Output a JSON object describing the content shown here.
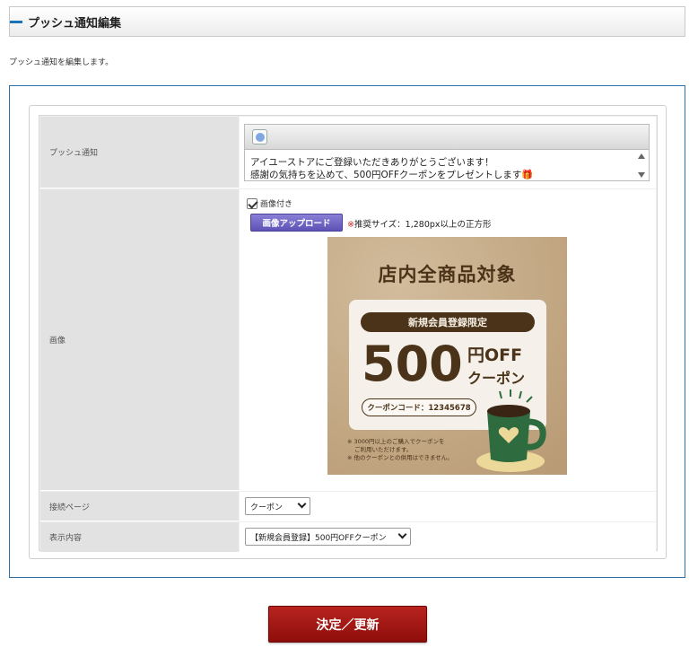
{
  "header": {
    "title": "プッシュ通知編集"
  },
  "subtitle": "プッシュ通知を編集します。",
  "form": {
    "push": {
      "label": "プッシュ通知",
      "line1": "アイユーストアにご登録いただきありがとうございます！",
      "line2": "感謝の気持ちを込めて、500円OFFクーポンをプレゼントします🎁"
    },
    "image": {
      "label": "画像",
      "checkbox_label": "画像付き",
      "checked": true,
      "upload_button": "画像アップロード",
      "note_mark": "※",
      "note_text": "推奨サイズ：1,280px以上の正方形",
      "coupon": {
        "headline": "店内全商品対象",
        "pill": "新規会員登録限定",
        "amount": "500",
        "off": "円OFF",
        "coupon_word": "クーポン",
        "code": "クーポンコード：12345678",
        "note1": "※ 3000円以上のご購入でクーポンを",
        "note2": "ご利用いただけます。",
        "note3": "※ 他のクーポンとの併用はできません。"
      }
    },
    "link_page": {
      "label": "接続ページ",
      "value": "クーポン"
    },
    "display": {
      "label": "表示内容",
      "value": "【新規会員登録】500円OFFクーポン"
    }
  },
  "submit_label": "決定／更新",
  "colors": {
    "accent": "#1a73b8",
    "submit": "#a01a16",
    "upload": "#6c60c4"
  }
}
